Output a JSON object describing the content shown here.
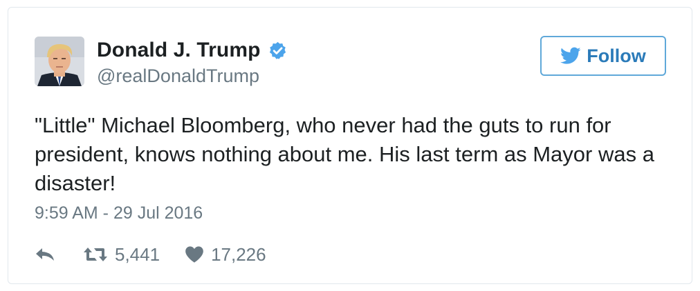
{
  "tweet": {
    "author": {
      "display_name": "Donald J. Trump",
      "handle": "@realDonaldTrump",
      "verified": true,
      "avatar_icon": "profile-photo"
    },
    "follow_button": {
      "label": "Follow",
      "icon": "twitter-bird-icon"
    },
    "text": "\"Little\" Michael Bloomberg, who never had the guts to run for president, knows nothing about me. His last term as Mayor was a disaster!",
    "timestamp": "9:59 AM - 29 Jul 2016",
    "actions": {
      "reply_icon": "reply-icon",
      "retweet_icon": "retweet-icon",
      "retweet_count": "5,441",
      "like_icon": "heart-icon",
      "like_count": "17,226"
    }
  },
  "colors": {
    "text_primary": "#1c2022",
    "text_secondary": "#697882",
    "verified_blue": "#4ca4eb",
    "follow_blue": "#2b7bb9",
    "follow_border": "#5fa8d9",
    "card_border": "#e1e8ed"
  }
}
